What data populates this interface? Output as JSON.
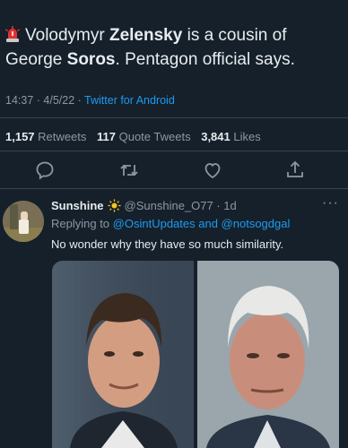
{
  "tweet": {
    "text_parts": [
      "Volodymyr ",
      "Zelensky",
      " is a cousin of George ",
      "Soros",
      ". Pentagon official says."
    ],
    "time": "14:37",
    "date": "4/5/22",
    "source": "Twitter for Android"
  },
  "stats": {
    "retweets_count": "1,157",
    "retweets_label": "Retweets",
    "quotes_count": "117",
    "quotes_label": "Quote Tweets",
    "likes_count": "3,841",
    "likes_label": "Likes"
  },
  "reply": {
    "name": "Sunshine",
    "handle": "@Sunshine_O77",
    "age": "1d",
    "replying_prefix": "Replying to",
    "replying_users": "@OsintUpdates and @notsogdgal",
    "text": "No wonder why they have so much similarity.",
    "more": "···"
  },
  "colors": {
    "background": "#15202b",
    "link": "#1d9bf0",
    "muted": "#8b98a5"
  },
  "icons": [
    "siren-icon",
    "comment-icon",
    "retweet-icon",
    "heart-icon",
    "share-icon",
    "sun-icon"
  ]
}
